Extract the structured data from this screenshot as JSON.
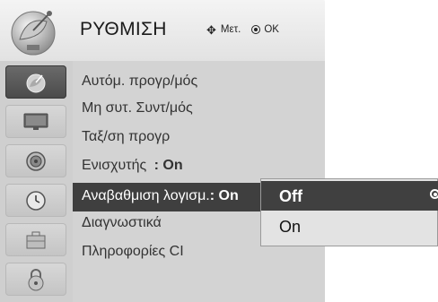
{
  "header": {
    "title": "ΡΥΘΜΙΣΗ",
    "hint_move": "Μετ.",
    "hint_ok": "OK",
    "icon": "satellite-dish-icon"
  },
  "sidebar": {
    "items": [
      {
        "icon": "satellite-dish-icon",
        "active": true
      },
      {
        "icon": "tv-monitor-icon",
        "active": false
      },
      {
        "icon": "speaker-icon",
        "active": false
      },
      {
        "icon": "clock-icon",
        "active": false
      },
      {
        "icon": "briefcase-icon",
        "active": false
      },
      {
        "icon": "lock-icon",
        "active": false
      }
    ]
  },
  "menu": {
    "items": [
      {
        "label": "Αυτόμ. προγρ/μός",
        "value": ""
      },
      {
        "label": "Μη συτ. Συντ/μός",
        "value": ""
      },
      {
        "label": "Ταξ/ση προγρ",
        "value": ""
      },
      {
        "label": "Ενισχυτής",
        "value": ": On"
      },
      {
        "label": "Αναβαθμιση λογισμ.",
        "value": ": On"
      },
      {
        "label": "Διαγνωστικά",
        "value": ""
      },
      {
        "label": "Πληροφορίες CI",
        "value": ""
      }
    ],
    "selected_index": 4
  },
  "popup": {
    "options": [
      "Off",
      "On"
    ],
    "selected": "Off"
  }
}
